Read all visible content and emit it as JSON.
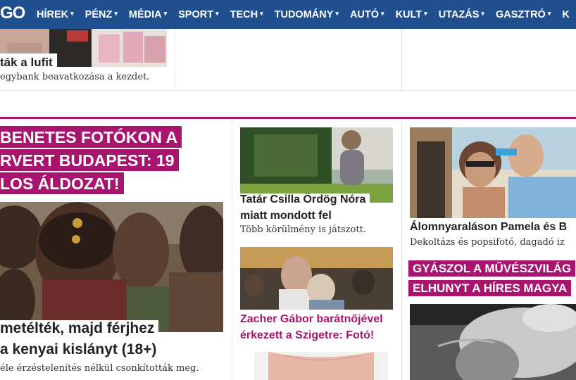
{
  "brand": {
    "logo_text": "GO"
  },
  "nav": {
    "items": [
      {
        "label": "HÍREK"
      },
      {
        "label": "PÉNZ"
      },
      {
        "label": "MÉDIA"
      },
      {
        "label": "SPORT"
      },
      {
        "label": "TECH"
      },
      {
        "label": "TUDOMÁNY"
      },
      {
        "label": "AUTÓ"
      },
      {
        "label": "KULT"
      },
      {
        "label": "UTAZÁS"
      },
      {
        "label": "GASZTRÓ"
      },
      {
        "label": "K"
      }
    ],
    "caret": "▾"
  },
  "top_row": {
    "article": {
      "title": "ták a lufit",
      "lead": "egybank beavatkozása a kezdet."
    }
  },
  "main": {
    "feature": {
      "banner_lines": [
        "BENETES FOTÓKON A",
        "RVERT BUDAPEST: 19",
        "LOS ÁLDOZAT!"
      ],
      "title_line1": "metélték, majd férjhez",
      "title_line2": "a kenyai kislányt (18+)",
      "lead": "éle érzéstelenítés nélkül csonkították meg."
    },
    "middle": [
      {
        "title_line1": "Tatár Csilla Ördög Nóra",
        "title_line2": "miatt mondott fel",
        "lead": "Több körülmény is játszott."
      },
      {
        "title_line1": "Zacher Gábor barátnőjével",
        "title_line2": "érkezett a Szigetre: Fotó!"
      }
    ],
    "right": {
      "article": {
        "title": "Álomnyaraláson Pamela és B",
        "lead": "Dekoltázs és popsifotó, dagadó iz"
      },
      "banner_lines": [
        "GYÁSZOL A MŰVÉSZVILÁG",
        "ELHUNYT A HÍRES MAGYA"
      ]
    }
  },
  "colors": {
    "nav_bg": "#1f4f8e",
    "accent": "#a8156f"
  }
}
